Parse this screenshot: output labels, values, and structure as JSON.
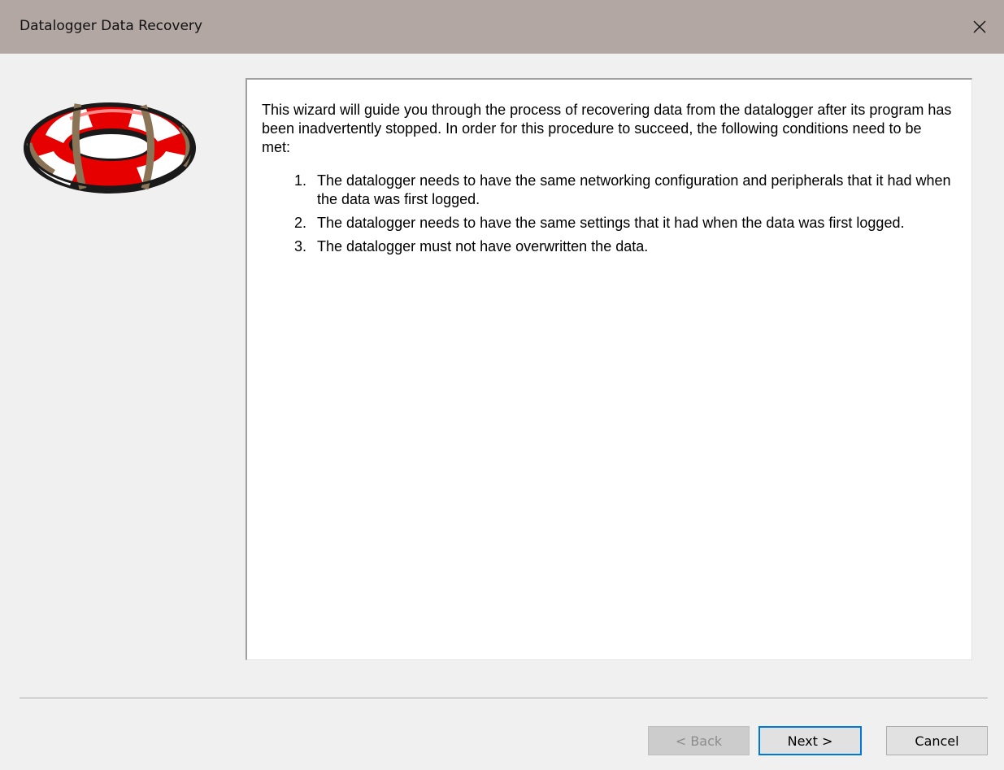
{
  "window": {
    "title": "Datalogger Data Recovery",
    "close_icon": "close-icon"
  },
  "logo": {
    "icon": "life-ring-icon",
    "colors": {
      "red": "#e60000",
      "white": "#ffffff",
      "strap": "#8b7355"
    }
  },
  "content": {
    "intro": "This wizard will guide you through the process of recovering data from the datalogger after its program has been inadvertently stopped. In order for this procedure to succeed, the following conditions need to be met:",
    "conditions": [
      {
        "num": "1.",
        "text": "The datalogger needs to have the same networking configuration and peripherals that it had when the data was first logged."
      },
      {
        "num": "2.",
        "text": "The datalogger needs to have the same settings that it had when the data was first logged."
      },
      {
        "num": "3.",
        "text": "The datalogger must not have overwritten the data."
      }
    ]
  },
  "buttons": {
    "back": "< Back",
    "next": "Next >",
    "cancel": "Cancel"
  },
  "colors": {
    "titlebar": "#b3a7a3",
    "focus": "#0078d7"
  }
}
